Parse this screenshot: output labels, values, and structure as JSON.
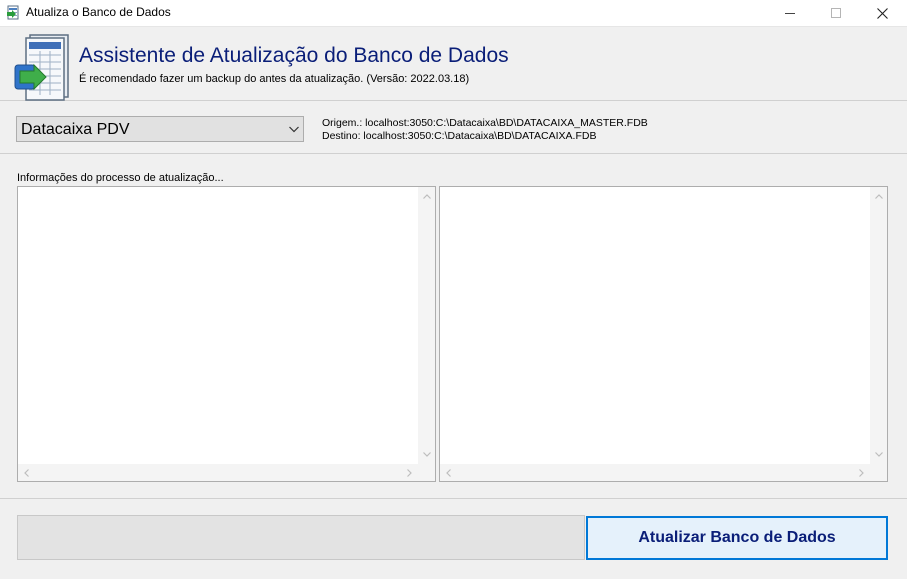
{
  "window": {
    "title": "Atualiza o Banco de Dados",
    "controls": [
      "minimize",
      "maximize",
      "close"
    ]
  },
  "header": {
    "title": "Assistente de Atualização do Banco de Dados",
    "subtitle": "É recomendado fazer um backup do antes da atualização. (Versão: 2022.03.18)",
    "icon": "database-update-icon"
  },
  "database_select": {
    "selected": "Datacaixa PDV"
  },
  "paths": {
    "origem": "Origem.: localhost:3050:C:\\Datacaixa\\BD\\DATACAIXA_MASTER.FDB",
    "destino": "Destino: localhost:3050:C:\\Datacaixa\\BD\\DATACAIXA.FDB"
  },
  "process": {
    "label": "Informações do processo de atualização...",
    "left_log": "",
    "right_log": ""
  },
  "progress": {
    "value": 0
  },
  "action": {
    "label": "Atualizar Banco de Dados"
  },
  "colors": {
    "title_blue": "#0a1e78",
    "button_border": "#0078d7",
    "progress_green": "#06b025"
  }
}
